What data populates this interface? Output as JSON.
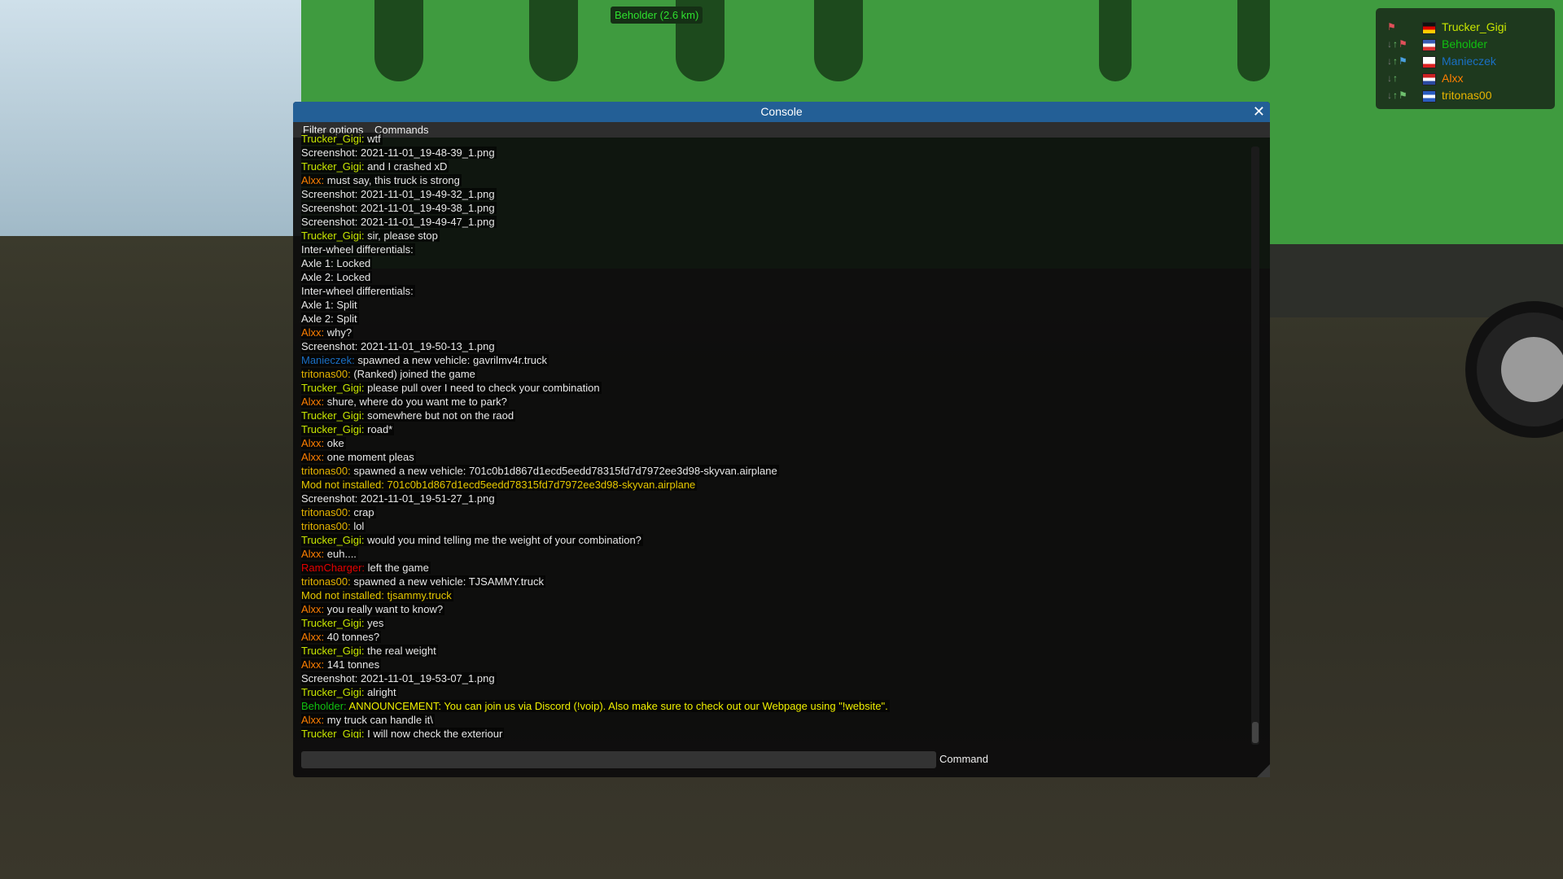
{
  "overlay": {
    "distance_label": "Beholder (2.6 km)"
  },
  "players": [
    {
      "name": "Trucker_Gigi",
      "color": "#c8e600",
      "flag": [
        "#111",
        "#d00",
        "#fc0"
      ],
      "arrows": "",
      "net": "#e0505a"
    },
    {
      "name": "Beholder",
      "color": "#10c010",
      "flag": [
        "#3a5bb5",
        "#fff",
        "#d33"
      ],
      "arrows": "↓↑",
      "net": "#e0505a"
    },
    {
      "name": "Manieczek",
      "color": "#1a6fc4",
      "flag": [
        "#fff",
        "#fff",
        "#d22"
      ],
      "arrows": "↓↑",
      "net": "#4aa0e0"
    },
    {
      "name": "Alxx",
      "color": "#ff7f00",
      "flag": [
        "#c22",
        "#fff",
        "#2a4aa0"
      ],
      "arrows": "↓↑",
      "net": ""
    },
    {
      "name": "tritonas00",
      "color": "#e6b400",
      "flag": [
        "#2a5bc0",
        "#fff",
        "#2a5bc0"
      ],
      "arrows": "↓↑",
      "net": "#6ec06e"
    }
  ],
  "console": {
    "title": "Console",
    "menu": [
      "Filter options",
      "Commands"
    ],
    "command_label": "Command",
    "command_value": "",
    "lines": [
      {
        "name": "Trucker_Gigi:",
        "nc": "#c8e600",
        "text": " wtf",
        "tc": "#e8e8e8"
      },
      {
        "name": "",
        "nc": "",
        "text": "Screenshot: 2021-11-01_19-48-39_1.png",
        "tc": "#e8e8e8"
      },
      {
        "name": "Trucker_Gigi:",
        "nc": "#c8e600",
        "text": " and I crashed xD",
        "tc": "#e8e8e8"
      },
      {
        "name": "Alxx:",
        "nc": "#ff7f00",
        "text": " must say, this truck is strong",
        "tc": "#e8e8e8"
      },
      {
        "name": "",
        "nc": "",
        "text": "Screenshot: 2021-11-01_19-49-32_1.png",
        "tc": "#e8e8e8"
      },
      {
        "name": "",
        "nc": "",
        "text": "Screenshot: 2021-11-01_19-49-38_1.png",
        "tc": "#e8e8e8"
      },
      {
        "name": "",
        "nc": "",
        "text": "Screenshot: 2021-11-01_19-49-47_1.png",
        "tc": "#e8e8e8"
      },
      {
        "name": "Trucker_Gigi:",
        "nc": "#c8e600",
        "text": " sir, please stop",
        "tc": "#e8e8e8"
      },
      {
        "name": "",
        "nc": "",
        "text": "Inter-wheel differentials:",
        "tc": "#e8e8e8"
      },
      {
        "name": "",
        "nc": "",
        "text": "Axle 1: Locked",
        "tc": "#e8e8e8"
      },
      {
        "name": "",
        "nc": "",
        "text": "Axle 2: Locked",
        "tc": "#e8e8e8"
      },
      {
        "name": "",
        "nc": "",
        "text": "Inter-wheel differentials:",
        "tc": "#e8e8e8"
      },
      {
        "name": "",
        "nc": "",
        "text": "Axle 1: Split",
        "tc": "#e8e8e8"
      },
      {
        "name": "",
        "nc": "",
        "text": "Axle 2: Split",
        "tc": "#e8e8e8"
      },
      {
        "name": "Alxx:",
        "nc": "#ff7f00",
        "text": " why?",
        "tc": "#e8e8e8"
      },
      {
        "name": "",
        "nc": "",
        "text": "Screenshot: 2021-11-01_19-50-13_1.png",
        "tc": "#e8e8e8"
      },
      {
        "name": "Manieczek:",
        "nc": "#1a6fc4",
        "text": " spawned a new vehicle: gavrilmv4r.truck",
        "tc": "#e8e8e8"
      },
      {
        "name": "tritonas00:",
        "nc": "#e6b400",
        "text": " (Ranked) joined the game",
        "tc": "#e8e8e8"
      },
      {
        "name": "Trucker_Gigi:",
        "nc": "#c8e600",
        "text": " please pull over I need to check your combination",
        "tc": "#e8e8e8"
      },
      {
        "name": "Alxx:",
        "nc": "#ff7f00",
        "text": " shure, where do you want me to park?",
        "tc": "#e8e8e8"
      },
      {
        "name": "Trucker_Gigi:",
        "nc": "#c8e600",
        "text": " somewhere but not on the raod",
        "tc": "#e8e8e8"
      },
      {
        "name": "Trucker_Gigi:",
        "nc": "#c8e600",
        "text": " road*",
        "tc": "#e8e8e8"
      },
      {
        "name": "Alxx:",
        "nc": "#ff7f00",
        "text": " oke",
        "tc": "#e8e8e8"
      },
      {
        "name": "Alxx:",
        "nc": "#ff7f00",
        "text": " one moment pleas",
        "tc": "#e8e8e8"
      },
      {
        "name": "tritonas00:",
        "nc": "#e6b400",
        "text": " spawned a new vehicle: 701c0b1d867d1ecd5eedd78315fd7d7972ee3d98-skyvan.airplane",
        "tc": "#e8e8e8"
      },
      {
        "name": "",
        "nc": "",
        "text": "Mod not installed: 701c0b1d867d1ecd5eedd78315fd7d7972ee3d98-skyvan.airplane",
        "tc": "#e6c800"
      },
      {
        "name": "",
        "nc": "",
        "text": "Screenshot: 2021-11-01_19-51-27_1.png",
        "tc": "#e8e8e8"
      },
      {
        "name": "tritonas00:",
        "nc": "#e6b400",
        "text": " crap",
        "tc": "#e8e8e8"
      },
      {
        "name": "tritonas00:",
        "nc": "#e6b400",
        "text": " lol",
        "tc": "#e8e8e8"
      },
      {
        "name": "Trucker_Gigi:",
        "nc": "#c8e600",
        "text": " would you mind telling me the weight of your combination?",
        "tc": "#e8e8e8"
      },
      {
        "name": "Alxx:",
        "nc": "#ff7f00",
        "text": " euh....",
        "tc": "#e8e8e8"
      },
      {
        "name": "RamCharger:",
        "nc": "#e60000",
        "text": " left the game",
        "tc": "#e8e8e8"
      },
      {
        "name": "tritonas00:",
        "nc": "#e6b400",
        "text": " spawned a new vehicle: TJSAMMY.truck",
        "tc": "#e8e8e8"
      },
      {
        "name": "",
        "nc": "",
        "text": "Mod not installed: tjsammy.truck",
        "tc": "#e6c800"
      },
      {
        "name": "Alxx:",
        "nc": "#ff7f00",
        "text": " you really want to know?",
        "tc": "#e8e8e8"
      },
      {
        "name": "Trucker_Gigi:",
        "nc": "#c8e600",
        "text": " yes",
        "tc": "#e8e8e8"
      },
      {
        "name": "Alxx:",
        "nc": "#ff7f00",
        "text": " 40 tonnes?",
        "tc": "#e8e8e8"
      },
      {
        "name": "Trucker_Gigi:",
        "nc": "#c8e600",
        "text": " the real weight",
        "tc": "#e8e8e8"
      },
      {
        "name": "Alxx:",
        "nc": "#ff7f00",
        "text": " 141 tonnes",
        "tc": "#e8e8e8"
      },
      {
        "name": "",
        "nc": "",
        "text": "Screenshot: 2021-11-01_19-53-07_1.png",
        "tc": "#e8e8e8"
      },
      {
        "name": "Trucker_Gigi:",
        "nc": "#c8e600",
        "text": " alright",
        "tc": "#e8e8e8"
      },
      {
        "name": "Beholder:",
        "nc": "#10c010",
        "text": " ANNOUNCEMENT: You can join us via Discord (!voip). Also make sure to check out our Webpage using \"!website\".",
        "tc": "#f0f000"
      },
      {
        "name": "Alxx:",
        "nc": "#ff7f00",
        "text": " my truck can handle it\\",
        "tc": "#e8e8e8"
      },
      {
        "name": "Trucker_Gigi:",
        "nc": "#c8e600",
        "text": " I will now check the exteriour",
        "tc": "#e8e8e8"
      }
    ]
  }
}
